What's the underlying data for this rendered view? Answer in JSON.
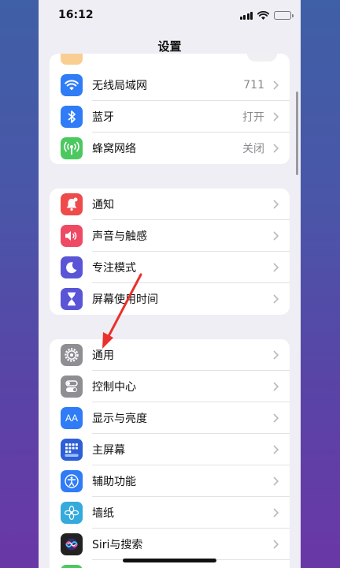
{
  "status_bar": {
    "time": "16:12"
  },
  "nav": {
    "title": "设置"
  },
  "group1": [
    {
      "label": "无线局域网",
      "value": "711",
      "icon": "wifi-icon",
      "color": "#2f7cf6"
    },
    {
      "label": "蓝牙",
      "value": "打开",
      "icon": "bluetooth-icon",
      "color": "#2f7cf6"
    },
    {
      "label": "蜂窝网络",
      "value": "关闭",
      "icon": "cellular-antenna-icon",
      "color": "#4cc860"
    }
  ],
  "group2": [
    {
      "label": "通知",
      "icon": "bell-icon",
      "color": "#ef4b4b"
    },
    {
      "label": "声音与触感",
      "icon": "speaker-icon",
      "color": "#ef4a63"
    },
    {
      "label": "专注模式",
      "icon": "moon-icon",
      "color": "#5a54d6"
    },
    {
      "label": "屏幕使用时间",
      "icon": "hourglass-icon",
      "color": "#5a54d6"
    }
  ],
  "group3": [
    {
      "label": "通用",
      "icon": "gear-icon",
      "color": "#8e8e93"
    },
    {
      "label": "控制中心",
      "icon": "toggle-icon",
      "color": "#8e8e93"
    },
    {
      "label": "显示与亮度",
      "icon": "text-size-icon",
      "color": "#2f7cf6"
    },
    {
      "label": "主屏幕",
      "icon": "home-grid-icon",
      "color": "#2f5fd6"
    },
    {
      "label": "辅助功能",
      "icon": "accessibility-icon",
      "color": "#2f7cf6"
    },
    {
      "label": "墙纸",
      "icon": "flower-icon",
      "color": "#35aadc"
    },
    {
      "label": "Siri与搜索",
      "icon": "siri-icon",
      "color": "#222222"
    }
  ],
  "icons": {
    "display_text": "AA"
  },
  "annotation": {
    "arrow_color": "#e8322b"
  }
}
